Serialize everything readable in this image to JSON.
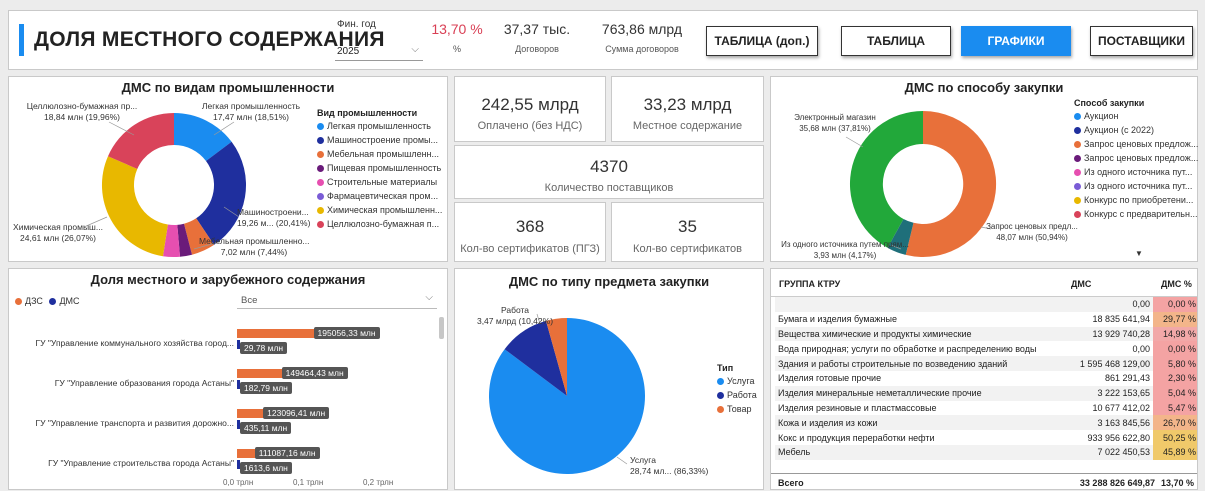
{
  "header": {
    "title": "ДОЛЯ МЕСТНОГО СОДЕРЖАНИЯ",
    "year_label": "Фин. год",
    "year_value": "2025",
    "pct_value": "13,70 %",
    "pct_label": "%",
    "contracts_value": "37,37 тыс.",
    "contracts_label": "Договоров",
    "sum_value": "763,86 млрд",
    "sum_label": "Сумма договоров"
  },
  "nav": {
    "table_extra": "ТАБЛИЦА (доп.)",
    "table": "ТАБЛИЦА",
    "charts": "ГРАФИКИ",
    "suppliers": "ПОСТАВЩИКИ"
  },
  "industry_panel": {
    "title": "ДМС по видам промышленности",
    "legend_title": "Вид промышленности",
    "legend": [
      {
        "label": "Легкая промышленность",
        "color": "#1a8cf0"
      },
      {
        "label": "Машиностроение промы...",
        "color": "#1f2f9e"
      },
      {
        "label": "Мебельная промышленн...",
        "color": "#e8703a"
      },
      {
        "label": "Пищевая промышленность",
        "color": "#6a1b7a"
      },
      {
        "label": "Строительные материалы",
        "color": "#e64fb0"
      },
      {
        "label": "Фармацевтическая пром...",
        "color": "#7a5cd6"
      },
      {
        "label": "Химическая промышленн...",
        "color": "#e8b800"
      },
      {
        "label": "Целлюлозно-бумажная п...",
        "color": "#d9435a"
      }
    ],
    "labels": {
      "cellulose_name": "Целлюлозно-бумажная пр...",
      "cellulose_val": "18,84 млн (19,96%)",
      "light_name": "Легкая промышленность",
      "light_val": "17,47 млн (18,51%)",
      "machine_name": "Машиностроени...",
      "machine_val": "19,26 м... (20,41%)",
      "furniture_name": "Мебельная промышленно...",
      "furniture_val": "7,02 млн (7,44%)",
      "chem_name": "Химическая промыш...",
      "chem_val": "24,61 млн (26,07%)"
    }
  },
  "kpis": {
    "paid_value": "242,55 млрд",
    "paid_label": "Оплачено (без НДС)",
    "local_value": "33,23 млрд",
    "local_label": "Местное содержание",
    "suppliers_value": "4370",
    "suppliers_label": "Количество поставщиков",
    "certs_pgz_value": "368",
    "certs_pgz_label": "Кол-во сертификатов (ПГЗ)",
    "certs_value": "35",
    "certs_label": "Кол-во сертификатов"
  },
  "method_panel": {
    "title": "ДМС по способу закупки",
    "legend_title": "Способ закупки",
    "legend": [
      {
        "label": "Аукцион",
        "color": "#1a8cf0"
      },
      {
        "label": "Аукцион (с 2022)",
        "color": "#1f2f9e"
      },
      {
        "label": "Запрос ценовых предлож...",
        "color": "#e8703a"
      },
      {
        "label": "Запрос ценовых предлож...",
        "color": "#6a1b7a"
      },
      {
        "label": "Из одного источника пут...",
        "color": "#e64fb0"
      },
      {
        "label": "Из одного источника пут...",
        "color": "#7a5cd6"
      },
      {
        "label": "Конкурс по приобретени...",
        "color": "#e8b800"
      },
      {
        "label": "Конкурс с предварительн...",
        "color": "#d9435a"
      }
    ],
    "labels": {
      "emag_name": "Электронный магазин",
      "emag_val": "35,68 млн (37,81%)",
      "zcp_name": "Запрос ценовых предл...",
      "zcp_val": "48,07 млн (50,94%)",
      "single_name": "Из одного источника путем прям...",
      "single_val": "3,93 млн (4,17%)"
    }
  },
  "foreign_panel": {
    "title": "Доля местного и зарубежного содержания",
    "legend": [
      {
        "label": "ДЗС",
        "color": "#e8703a"
      },
      {
        "label": "ДМС",
        "color": "#1f2f9e"
      }
    ],
    "filter_value": "Все",
    "rows": [
      {
        "name": "ГУ \"Управление коммунального хозяйства город...",
        "dzs": "195056,33 млн",
        "dms": "29,78 млн"
      },
      {
        "name": "ГУ \"Управление образования города Астаны\"",
        "dzs": "149464,43 млн",
        "dms": "182,79 млн"
      },
      {
        "name": "ГУ \"Управление транспорта и развития дорожно...",
        "dzs": "123096,41 млн",
        "dms": "435,11 млн"
      },
      {
        "name": "ГУ \"Управление строительства города Астаны\"",
        "dzs": "111087,16 млн",
        "dms": "1613,6 млн"
      }
    ],
    "axis": [
      "0,0 трлн",
      "0,1 трлн",
      "0,2 трлн"
    ]
  },
  "type_panel": {
    "title": "ДМС по типу предмета закупки",
    "legend_title": "Тип",
    "legend": [
      {
        "label": "Услуга",
        "color": "#1a8cf0"
      },
      {
        "label": "Работа",
        "color": "#1f2f9e"
      },
      {
        "label": "Товар",
        "color": "#e8703a"
      }
    ],
    "labels": {
      "work_name": "Работа",
      "work_val": "3,47 млрд (10,42%)",
      "service_name": "Услуга",
      "service_val": "28,74 мл... (86,33%)"
    }
  },
  "ktru_table": {
    "headers": [
      "ГРУППА КТРУ",
      "ДМС",
      "ДМС %"
    ],
    "rows": [
      {
        "name": "",
        "dms": "0,00",
        "pct": "0,00 %"
      },
      {
        "name": "Бумага и изделия бумажные",
        "dms": "18 835 641,94",
        "pct": "29,77 %"
      },
      {
        "name": "Вещества химические и продукты химические",
        "dms": "13 929 740,28",
        "pct": "14,98 %"
      },
      {
        "name": "Вода природная; услуги по обработке и распределению воды",
        "dms": "0,00",
        "pct": "0,00 %"
      },
      {
        "name": "Здания и работы строительные по возведению зданий",
        "dms": "1 595 468 129,00",
        "pct": "5,80 %"
      },
      {
        "name": "Изделия готовые прочие",
        "dms": "861 291,43",
        "pct": "2,30 %"
      },
      {
        "name": "Изделия минеральные неметаллические прочие",
        "dms": "3 222 153,65",
        "pct": "5,04 %"
      },
      {
        "name": "Изделия резиновые и пластмассовые",
        "dms": "10 677 412,02",
        "pct": "5,47 %"
      },
      {
        "name": "Кожа и изделия из кожи",
        "dms": "3 163 845,56",
        "pct": "26,70 %"
      },
      {
        "name": "Кокс и продукция переработки нефти",
        "dms": "933 956 622,80",
        "pct": "50,25 %"
      },
      {
        "name": "Мебель",
        "dms": "7 022 450,53",
        "pct": "45,89 %"
      }
    ],
    "total_label": "Всего",
    "total_dms": "33 288 826 649,87",
    "total_pct": "13,70 %"
  }
}
